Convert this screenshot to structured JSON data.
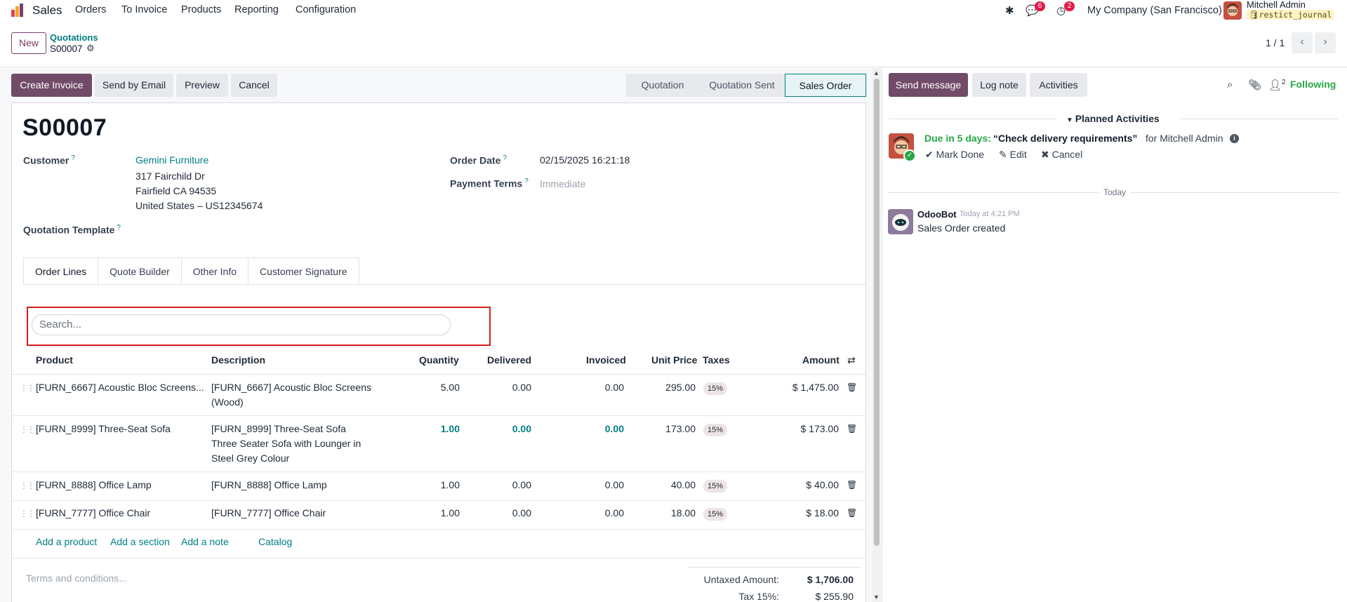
{
  "navbar": {
    "app_name": "Sales",
    "menu": [
      "Orders",
      "To Invoice",
      "Products",
      "Reporting",
      "Configuration"
    ],
    "messages_count": "6",
    "activities_count": "2",
    "company": "My Company (San Francisco)",
    "user_name": "Mitchell Admin",
    "database": "restict_journal"
  },
  "control_panel": {
    "new_label": "New",
    "breadcrumb_parent": "Quotations",
    "breadcrumb_current": "S00007",
    "pager": "1 / 1"
  },
  "actions": {
    "create_invoice": "Create Invoice",
    "send_by_email": "Send by Email",
    "preview": "Preview",
    "cancel": "Cancel"
  },
  "status_steps": [
    "Quotation",
    "Quotation Sent",
    "Sales Order"
  ],
  "status_active": "Sales Order",
  "form": {
    "title": "S00007",
    "customer_label": "Customer",
    "customer_name": "Gemini Furniture",
    "address_line1": "317 Fairchild Dr",
    "address_line2": "Fairfield CA 94535",
    "address_line3": "United States – US12345674",
    "template_label": "Quotation Template",
    "order_date_label": "Order Date",
    "order_date": "02/15/2025 16:21:18",
    "payment_terms_label": "Payment Terms",
    "payment_terms": "Immediate",
    "help": "?"
  },
  "tabs": [
    "Order Lines",
    "Quote Builder",
    "Other Info",
    "Customer Signature"
  ],
  "search": {
    "placeholder": "Search..."
  },
  "table": {
    "columns": [
      "Product",
      "Description",
      "Quantity",
      "Delivered",
      "Invoiced",
      "Unit Price",
      "Taxes",
      "Amount"
    ],
    "rows": [
      {
        "product": "[FURN_6667] Acoustic Bloc Screens...",
        "description": "[FURN_6667] Acoustic Bloc Screens (Wood)",
        "quantity": "5.00",
        "delivered": "0.00",
        "invoiced": "0.00",
        "unit_price": "295.00",
        "tax": "15%",
        "amount": "$ 1,475.00"
      },
      {
        "product": "[FURN_8999] Three-Seat Sofa",
        "description": "[FURN_8999] Three-Seat Sofa Three Seater Sofa with Lounger in Steel Grey Colour",
        "quantity": "1.00",
        "delivered": "0.00",
        "invoiced": "0.00",
        "unit_price": "173.00",
        "tax": "15%",
        "amount": "$ 173.00"
      },
      {
        "product": "[FURN_8888] Office Lamp",
        "description": "[FURN_8888] Office Lamp",
        "quantity": "1.00",
        "delivered": "0.00",
        "invoiced": "0.00",
        "unit_price": "40.00",
        "tax": "15%",
        "amount": "$ 40.00"
      },
      {
        "product": "[FURN_7777] Office Chair",
        "description": "[FURN_7777] Office Chair",
        "quantity": "1.00",
        "delivered": "0.00",
        "invoiced": "0.00",
        "unit_price": "18.00",
        "tax": "15%",
        "amount": "$ 18.00"
      }
    ],
    "add_product": "Add a product",
    "add_section": "Add a section",
    "add_note": "Add a note",
    "catalog": "Catalog"
  },
  "footer": {
    "terms_placeholder": "Terms and conditions...",
    "untaxed_label": "Untaxed Amount:",
    "untaxed_value": "$ 1,706.00",
    "tax_label": "Tax 15%:",
    "tax_value": "$ 255.90"
  },
  "chatter": {
    "send_message": "Send message",
    "log_note": "Log note",
    "activities": "Activities",
    "followers_count": "2",
    "following": "Following",
    "planned_title": "Planned Activities",
    "activity_due": "Due in 5 days:",
    "activity_summary": "“Check delivery requirements”",
    "activity_for": "for Mitchell Admin",
    "mark_done": "Mark Done",
    "edit": "Edit",
    "cancel": "Cancel",
    "today": "Today",
    "bot_name": "OdooBot",
    "bot_time": "Today at 4:21 PM",
    "bot_message": "Sales Order created"
  },
  "colors": {
    "primary": "#714b67",
    "link": "#017e84",
    "success": "#28a745",
    "highlight_border": "#d21f1f"
  }
}
